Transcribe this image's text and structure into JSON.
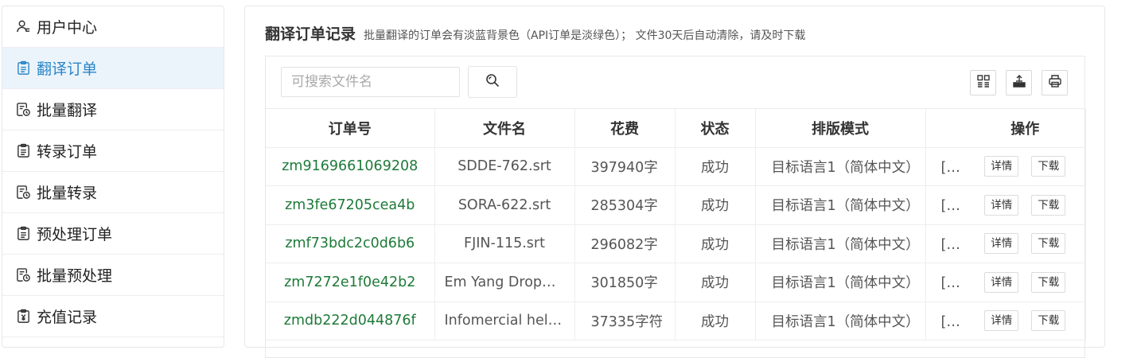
{
  "sidebar": {
    "items": [
      {
        "label": "用户中心",
        "icon": "user-icon",
        "active": false
      },
      {
        "label": "翻译订单",
        "icon": "clipboard-icon",
        "active": true
      },
      {
        "label": "批量翻译",
        "icon": "batch-doc-icon",
        "active": false
      },
      {
        "label": "转录订单",
        "icon": "clipboard-icon",
        "active": false
      },
      {
        "label": "批量转录",
        "icon": "batch-doc-icon",
        "active": false
      },
      {
        "label": "预处理订单",
        "icon": "clipboard-icon",
        "active": false
      },
      {
        "label": "批量预处理",
        "icon": "batch-doc-icon",
        "active": false
      },
      {
        "label": "充值记录",
        "icon": "yuan-clipboard-icon",
        "active": false
      }
    ]
  },
  "header": {
    "title": "翻译订单记录",
    "subtitle": "批量翻译的订单会有淡蓝背景色（API订单是淡绿色）；  文件30天后自动清除，请及时下载"
  },
  "search": {
    "placeholder": "可搜索文件名",
    "value": ""
  },
  "table": {
    "columns": [
      "订单号",
      "文件名",
      "花费",
      "状态",
      "排版模式",
      "",
      "操作"
    ],
    "rows": [
      {
        "order": "zm9169661069208",
        "file": "SDDE-762.srt",
        "cost": "397940字",
        "status": "成功",
        "layout": "目标语言1（简体中文）",
        "extra": "[官]",
        "detail": "详情",
        "download": "下载"
      },
      {
        "order": "zm3fe67205cea4b",
        "file": "SORA-622.srt",
        "cost": "285304字",
        "status": "成功",
        "layout": "目标语言1（简体中文）",
        "extra": "[官]",
        "detail": "详情",
        "download": "下载"
      },
      {
        "order": "zmf73bdc2c0d6b6",
        "file": "FJIN-115.srt",
        "cost": "296082字",
        "status": "成功",
        "layout": "目标语言1（简体中文）",
        "extra": "[官]",
        "detail": "详情",
        "download": "下载"
      },
      {
        "order": "zm7272e1f0e42b2",
        "file": "Em Yang Dropping.srt",
        "cost": "301850字",
        "status": "成功",
        "layout": "目标语言1（简体中文）",
        "extra": "[官]",
        "detail": "详情",
        "download": "下载"
      },
      {
        "order": "zmdb222d044876f",
        "file": "Infomercial hell.srt",
        "cost": "37335字符",
        "status": "成功",
        "layout": "目标语言1（简体中文）",
        "extra": "[官]",
        "detail": "详情",
        "download": "下载"
      }
    ]
  },
  "colors": {
    "accent": "#2a86c8",
    "order_link": "#1e7a39",
    "active_bg": "#ecf4fb"
  }
}
